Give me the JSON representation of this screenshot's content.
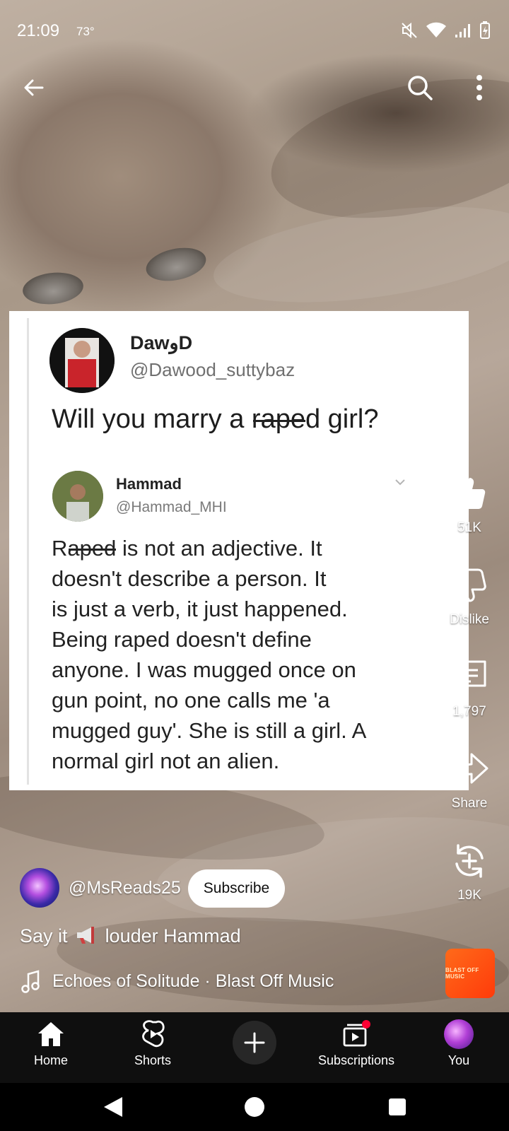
{
  "status_bar": {
    "time": "21:09",
    "temperature": "73°"
  },
  "tweet": {
    "author_name": "DawوD",
    "author_handle": "@Dawood_suttybaz",
    "question_before": "Will you marry a ",
    "question_struck": "rape",
    "question_after": "d girl?",
    "reply_name": "Hammad",
    "reply_handle": "@Hammad_MHI",
    "reply_first_char": "R",
    "reply_struck": "aped",
    "reply_rest_first_line": " is not an adjective. It",
    "reply_body": "doesn't describe a person. It\nis just a verb, it just happened.\nBeing raped doesn't define\nanyone. I was mugged once on\ngun point, no one calls me 'a\nmugged guy'. She is still a girl. A\nnormal girl not an alien."
  },
  "actions": {
    "like_count": "51K",
    "dislike_label": "Dislike",
    "comment_count": "1,797",
    "share_label": "Share",
    "remix_count": "19K"
  },
  "channel": {
    "handle": "@MsReads25",
    "subscribe_label": "Subscribe"
  },
  "caption": {
    "before": "Say it",
    "after": "louder Hammad"
  },
  "music": {
    "text": "Echoes of Solitude · Blast Off Music",
    "album_label": "BLAST OFF MUSIC"
  },
  "nav": {
    "home": "Home",
    "shorts": "Shorts",
    "subscriptions": "Subscriptions",
    "you": "You"
  },
  "colors": {
    "nav_background": "#0f0f0f",
    "notification_dot": "#ff0033",
    "album_orange": "#ff4f12"
  }
}
